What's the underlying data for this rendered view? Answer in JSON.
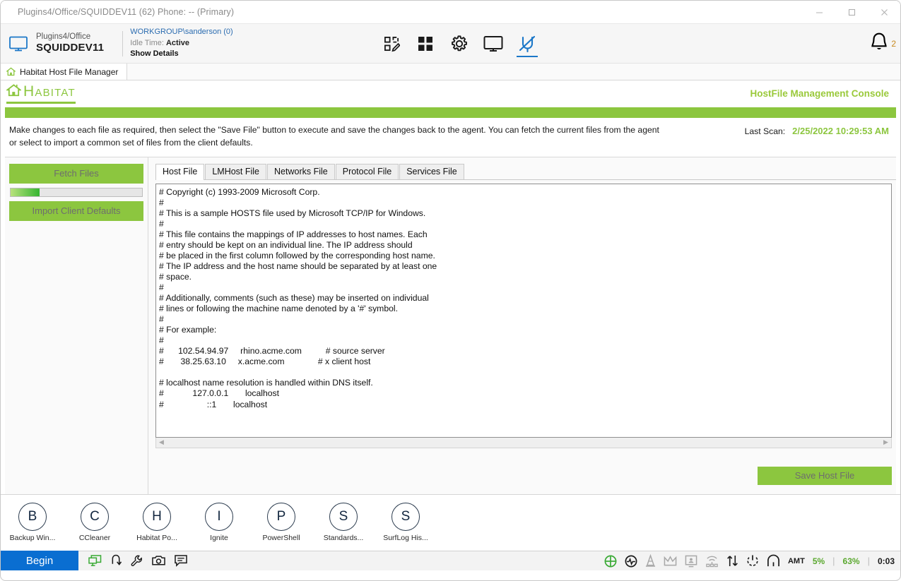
{
  "window": {
    "title": "Plugins4/Office/SQUIDDEV11 (62) Phone: -- (Primary)",
    "minimize_label": "minimize-icon",
    "maximize_label": "maximize-icon",
    "close_label": "close-icon"
  },
  "device_header": {
    "monitor_icon": "monitor-icon",
    "org": "Plugins4/Office",
    "name": "SQUIDDEV11",
    "user": "WORKGROUP\\sanderson (0)",
    "idle_label": "Idle Time:",
    "idle_value": "Active",
    "show_details": "Show Details",
    "icons": [
      {
        "name": "edit-grid-icon"
      },
      {
        "name": "grid-icon"
      },
      {
        "name": "gear-icon"
      },
      {
        "name": "monitor-icon"
      },
      {
        "name": "plug-icon",
        "active": true
      }
    ],
    "bell_icon": "bell-icon",
    "bell_count": "2"
  },
  "page_tab": {
    "home_icon": "home-icon",
    "label": "Habitat Host File Manager"
  },
  "brand": {
    "house_icon": "house-icon",
    "word": "Habitat",
    "console_title": "HostFile Management Console"
  },
  "instructions": {
    "text": "Make changes to each file as required, then select the \"Save File\" button to execute and save the changes back to the agent. You can fetch the current files from the agent or select to import a common set of files from the client defaults.",
    "last_scan_label": "Last Scan:",
    "last_scan_value": "2/25/2022 10:29:53 AM"
  },
  "left_pane": {
    "fetch_label": "Fetch Files",
    "import_label": "Import Client Defaults",
    "progress_percent": 22
  },
  "tabs": [
    {
      "label": "Host File",
      "active": true
    },
    {
      "label": "LMHost File",
      "active": false
    },
    {
      "label": "Networks File",
      "active": false
    },
    {
      "label": "Protocol File",
      "active": false
    },
    {
      "label": "Services File",
      "active": false
    }
  ],
  "editor": {
    "content": "# Copyright (c) 1993-2009 Microsoft Corp.\n#\n# This is a sample HOSTS file used by Microsoft TCP/IP for Windows.\n#\n# This file contains the mappings of IP addresses to host names. Each\n# entry should be kept on an individual line. The IP address should\n# be placed in the first column followed by the corresponding host name.\n# The IP address and the host name should be separated by at least one\n# space.\n#\n# Additionally, comments (such as these) may be inserted on individual\n# lines or following the machine name denoted by a '#' symbol.\n#\n# For example:\n#\n#      102.54.94.97     rhino.acme.com          # source server\n#       38.25.63.10     x.acme.com              # x client host\n\n# localhost name resolution is handled within DNS itself.\n#            127.0.0.1       localhost\n#                  ::1       localhost"
  },
  "scrollbar": {
    "left_arrow": "scroll-left-icon",
    "right_arrow": "scroll-right-icon"
  },
  "save": {
    "label": "Save Host File"
  },
  "dock": {
    "items": [
      {
        "letter": "B",
        "label": "Backup Win..."
      },
      {
        "letter": "C",
        "label": "CCleaner"
      },
      {
        "letter": "H",
        "label": "Habitat Po..."
      },
      {
        "letter": "I",
        "label": "Ignite"
      },
      {
        "letter": "P",
        "label": "PowerShell"
      },
      {
        "letter": "S",
        "label": "Standards..."
      },
      {
        "letter": "S",
        "label": "SurfLog His..."
      }
    ]
  },
  "statusbar": {
    "begin_label": "Begin",
    "left_icons": [
      {
        "name": "remote-screens-icon"
      },
      {
        "name": "undo-arrow-icon"
      },
      {
        "name": "wrench-icon"
      },
      {
        "name": "camera-icon"
      },
      {
        "name": "chat-icon"
      }
    ],
    "right_icons": [
      {
        "name": "target-icon"
      },
      {
        "name": "heartbeat-icon"
      },
      {
        "name": "cone-icon"
      },
      {
        "name": "crown-icon"
      },
      {
        "name": "user-monitor-icon"
      },
      {
        "name": "network-icon"
      },
      {
        "name": "transfer-icon"
      },
      {
        "name": "power-icon"
      },
      {
        "name": "habitat-arch-icon"
      }
    ],
    "amt_label": "AMT",
    "amt_value": "5%",
    "battery_value": "63%",
    "time_value": "0:03",
    "divider": "|"
  },
  "colors": {
    "habitat_green": "#8cc63f",
    "accent_blue": "#1b77c8",
    "begin_blue": "#0a6ed1",
    "badge_orange": "#c8891f"
  }
}
